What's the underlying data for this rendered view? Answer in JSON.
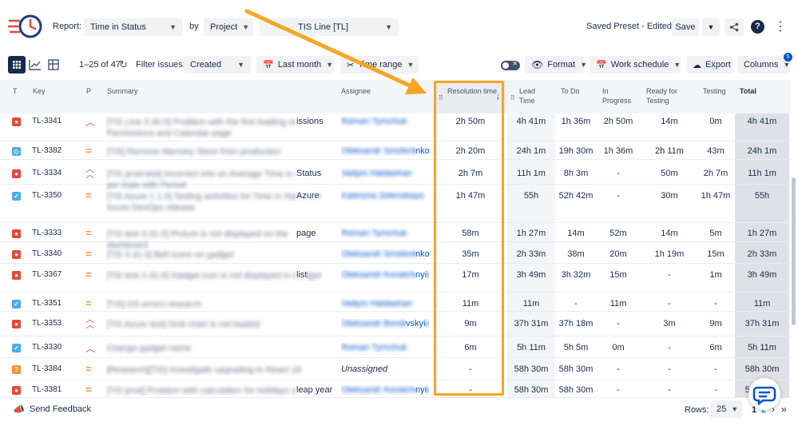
{
  "header": {
    "report_label": "Report:",
    "report_value": "Time in Status",
    "by_label": "by",
    "by_value": "Project",
    "project_value": "TIS Line [TL]",
    "preset_label": "Saved Preset - Edited",
    "save_label": "Save"
  },
  "toolbar": {
    "range_text": "1–25 of 47",
    "filter_label": "Filter issues:",
    "filter_value": "Created",
    "date_value": "Last month",
    "time_range_label": "Time range",
    "format_label": "Format",
    "work_schedule_label": "Work schedule",
    "export_label": "Export",
    "columns_label": "Columns",
    "columns_badge": "5"
  },
  "table": {
    "headers": {
      "type": "T",
      "key": "Key",
      "priority": "P",
      "summary": "Summary",
      "assignee": "Assignee",
      "resolution": "Resolution time",
      "lead": "Lead Time",
      "todo": "To Do",
      "in_progress": "In Progress",
      "ready": "Ready for Testing",
      "testing": "Testing",
      "total": "Total"
    },
    "rows": [
      {
        "type": "bug",
        "key": "TL-3341",
        "priority": "high",
        "summary_blur": "[TIS Line 3.30.0] Problem with the first loading on Permissions and Calendar page",
        "summary_tail": "issions",
        "assignee_blur": "Roman Tymchuk",
        "assignee_tail": "",
        "resolution": "2h 50m",
        "lead": "4h 41m",
        "todo": "1h 36m",
        "in_progress": "2h 50m",
        "ready": "14m",
        "testing": "0m",
        "total": "4h 41m"
      },
      {
        "type": "task",
        "key": "TL-3382",
        "priority": "medium",
        "summary_blur": "[TIS] Remove Memory Store from production",
        "summary_tail": "",
        "assignee_blur": "Oleksandr Smolenko",
        "assignee_tail": "nko",
        "resolution": "2h 20m",
        "lead": "24h 1m",
        "todo": "19h 30m",
        "in_progress": "1h 36m",
        "ready": "2h 11m",
        "testing": "43m",
        "total": "24h 1m"
      },
      {
        "type": "bug",
        "key": "TL-3334",
        "priority": "highest",
        "summary_blur": "[TIS prod-test] Incorrect info on Average Time in Status per Date with Period",
        "summary_tail": "Status",
        "assignee_blur": "Vadym Haidashan",
        "assignee_tail": "",
        "resolution": "2h 7m",
        "lead": "11h 1m",
        "todo": "8h 3m",
        "in_progress": "-",
        "ready": "50m",
        "testing": "2h 7m",
        "total": "11h 1m"
      },
      {
        "type": "story",
        "key": "TL-3350",
        "priority": "medium",
        "summary_blur": "[TIS Azure 1.1.0] Testing activities for Time in Status for Azure DevOps release",
        "summary_tail": "Azure",
        "assignee_blur": "Kateryna Zelenskaya",
        "assignee_tail": "",
        "resolution": "1h 47m",
        "lead": "55h",
        "todo": "52h 42m",
        "in_progress": "-",
        "ready": "30m",
        "testing": "1h 47m",
        "total": "55h"
      },
      {
        "type": "bug",
        "key": "TL-3333",
        "priority": "medium",
        "summary_blur": "[TIS test 3.31.0] Picture is not displayed on the dashboard",
        "summary_tail": "page",
        "assignee_blur": "Roman Tymchuk",
        "assignee_tail": "",
        "resolution": "58m",
        "lead": "1h 27m",
        "todo": "14m",
        "in_progress": "52m",
        "ready": "14m",
        "testing": "5m",
        "total": "1h 27m"
      },
      {
        "type": "bug",
        "key": "TL-3340",
        "priority": "medium",
        "summary_blur": "[TIS 3.31.0] Bell Icons on gadget",
        "summary_tail": "",
        "assignee_blur": "Oleksandr Smolenko",
        "assignee_tail": "nko",
        "resolution": "35m",
        "lead": "2h 33m",
        "todo": "38m",
        "in_progress": "20m",
        "ready": "1h 19m",
        "testing": "15m",
        "total": "2h 33m"
      },
      {
        "type": "bug",
        "key": "TL-3367",
        "priority": "medium",
        "summary_blur": "[TIS test 3.32.0] Gadget icon is not displayed in Gadget",
        "summary_tail": "list",
        "assignee_blur": "Oleksandr Kovalchenko",
        "assignee_tail": "nyi",
        "resolution": "17m",
        "lead": "3h 49m",
        "todo": "3h 32m",
        "in_progress": "15m",
        "ready": "-",
        "testing": "1m",
        "total": "3h 49m"
      },
      {
        "type": "story",
        "key": "TL-3351",
        "priority": "medium",
        "summary_blur": "[TIS] DS errors research",
        "summary_tail": "",
        "assignee_blur": "Vadym Haidashan",
        "assignee_tail": "",
        "resolution": "11m",
        "lead": "11m",
        "todo": "-",
        "in_progress": "11m",
        "ready": "-",
        "testing": "-",
        "total": "11m"
      },
      {
        "type": "bug",
        "key": "TL-3353",
        "priority": "highest",
        "summary_blur": "[TIS Azure test] Grid chart is not loaded",
        "summary_tail": "",
        "assignee_blur": "Oleksandr Bondarenkovskyi",
        "assignee_tail": "vskyi",
        "resolution": "9m",
        "lead": "37h 31m",
        "todo": "37h 18m",
        "in_progress": "-",
        "ready": "3m",
        "testing": "9m",
        "total": "37h 31m"
      },
      {
        "type": "story",
        "key": "TL-3330",
        "priority": "high",
        "summary_blur": "Change gadget name",
        "summary_tail": "",
        "assignee_blur": "Roman Tymchuk",
        "assignee_tail": "",
        "resolution": "6m",
        "lead": "5h 11m",
        "todo": "5h 5m",
        "in_progress": "0m",
        "ready": "-",
        "testing": "6m",
        "total": "5h 11m"
      },
      {
        "type": "improvement",
        "key": "TL-3384",
        "priority": "medium",
        "summary_blur": "[Research][TIS] Investigate upgrading to React 18",
        "summary_tail": "",
        "assignee_blur": "",
        "assignee_tail": "Unassigned",
        "resolution": "-",
        "lead": "58h 30m",
        "todo": "58h 30m",
        "in_progress": "-",
        "ready": "-",
        "testing": "-",
        "total": "58h 30m"
      },
      {
        "type": "bug",
        "key": "TL-3381",
        "priority": "medium",
        "summary_blur": "[TIS prod] Problem with calculation for holidays on the",
        "summary_tail": "leap year",
        "assignee_blur": "Oleksandr Kovalchenko",
        "assignee_tail": "nyi",
        "resolution": "-",
        "lead": "58h 30m",
        "todo": "58h 30m",
        "in_progress": "-",
        "ready": "-",
        "testing": "-",
        "total": "58h 30m"
      }
    ]
  },
  "footer": {
    "feedback_label": "Send Feedback",
    "rows_label": "Rows:",
    "rows_value": "25",
    "page_current": "1",
    "page_next": "2"
  },
  "colors": {
    "accent": "#0052cc",
    "highlight": "#f5a623",
    "bug": "#e5493a",
    "story": "#4bade8",
    "improvement": "#f79232"
  }
}
